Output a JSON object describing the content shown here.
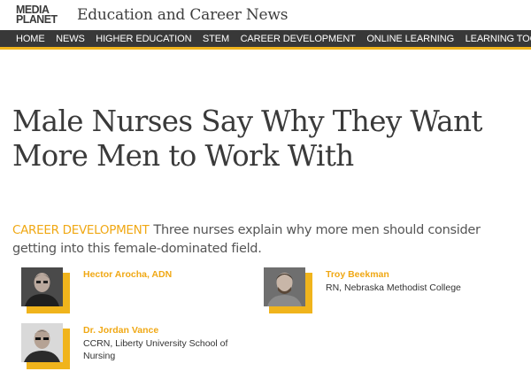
{
  "masthead": {
    "logo_line1": "MEDIA",
    "logo_line2": "PLANET",
    "site_title": "Education and Career News"
  },
  "nav": {
    "items": [
      {
        "label": "HOME"
      },
      {
        "label": "NEWS"
      },
      {
        "label": "HIGHER EDUCATION"
      },
      {
        "label": "STEM"
      },
      {
        "label": "CAREER DEVELOPMENT"
      },
      {
        "label": "ONLINE LEARNING"
      },
      {
        "label": "LEARNING TOOLS"
      }
    ]
  },
  "article": {
    "headline": "Male Nurses Say Why They Want More Men to Work With",
    "category": "CAREER DEVELOPMENT",
    "deck": "Three nurses explain why more men should consider getting into this female-dominated field."
  },
  "authors": [
    {
      "name": "Hector Arocha, ADN",
      "role": ""
    },
    {
      "name": "Troy Beekman",
      "role": "RN, Nebraska Methodist College"
    },
    {
      "name": "Dr. Jordan Vance",
      "role": "CCRN, Liberty University School of Nursing"
    }
  ],
  "colors": {
    "accent": "#f0b41c",
    "nav_bg": "#383838",
    "category_text": "#f0a814"
  }
}
